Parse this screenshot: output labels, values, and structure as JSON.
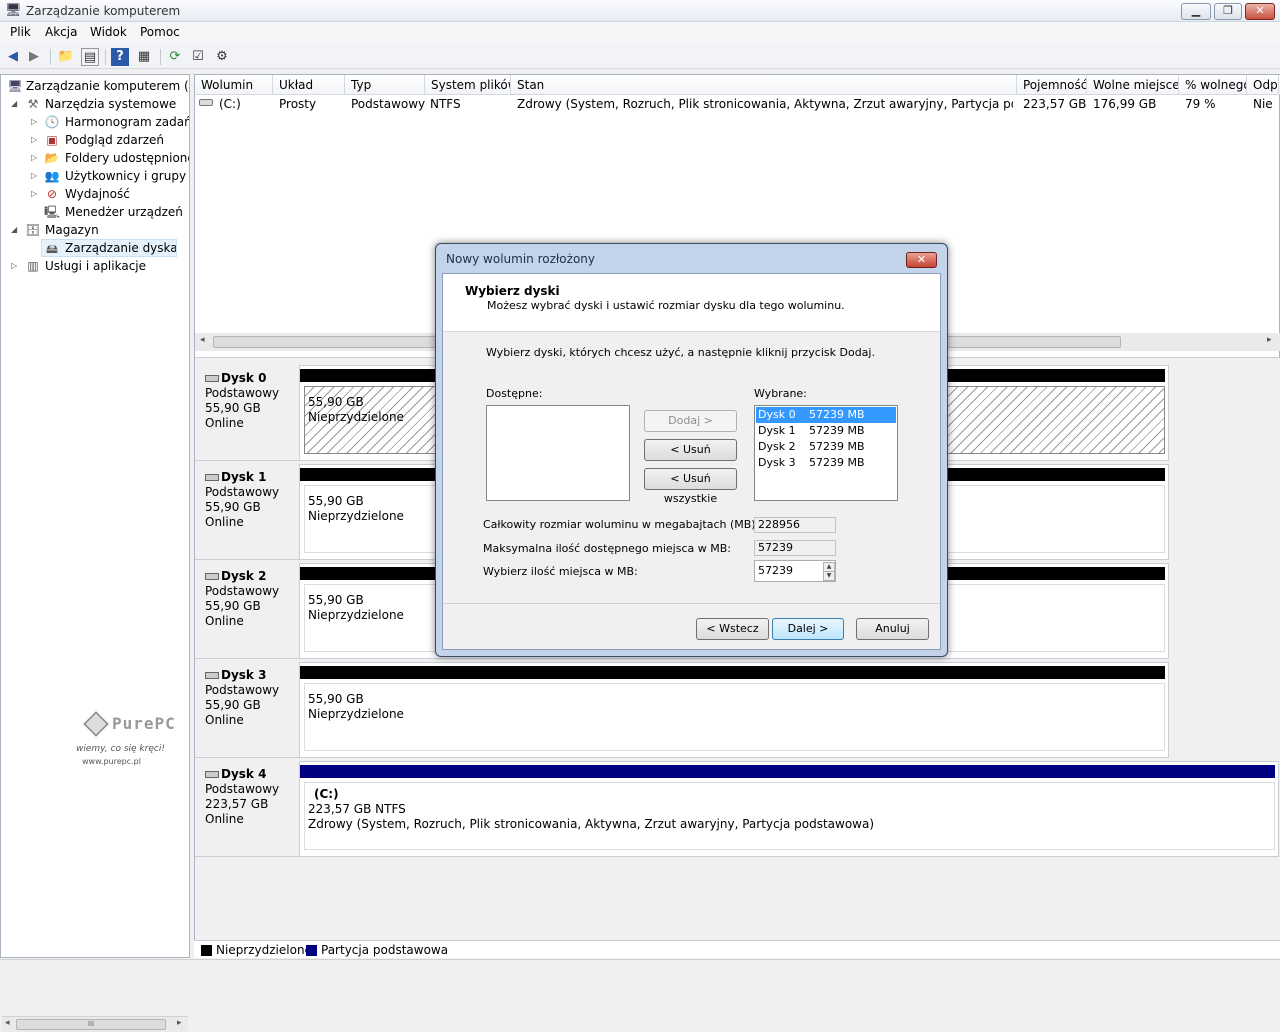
{
  "window": {
    "title": "Zarządzanie komputerem",
    "minimize": "▁",
    "maximize": "❐",
    "close": "✕"
  },
  "menu": [
    "Plik",
    "Akcja",
    "Widok",
    "Pomoc"
  ],
  "tree": {
    "root": "Zarządzanie komputerem (lokalne)",
    "items": [
      {
        "label": "Narzędzia systemowe",
        "icon": "tools-icon"
      },
      {
        "label": "Harmonogram zadań",
        "icon": "clock-icon"
      },
      {
        "label": "Podgląd zdarzeń",
        "icon": "event-viewer-icon"
      },
      {
        "label": "Foldery udostępnione",
        "icon": "shared-folder-icon"
      },
      {
        "label": "Użytkownicy i grupy lokalne",
        "icon": "users-icon"
      },
      {
        "label": "Wydajność",
        "icon": "performance-icon"
      },
      {
        "label": "Menedżer urządzeń",
        "icon": "device-manager-icon"
      },
      {
        "label": "Magazyn",
        "icon": "storage-icon"
      },
      {
        "label": "Zarządzanie dyskami",
        "icon": "disk-management-icon"
      },
      {
        "label": "Usługi i aplikacje",
        "icon": "services-icon"
      }
    ],
    "scroll_mid": "III"
  },
  "volume_table": {
    "columns": [
      "Wolumin",
      "Układ",
      "Typ",
      "System plików",
      "Stan",
      "Pojemność",
      "Wolne miejsce",
      "% wolnego",
      "Odporność na błędy"
    ],
    "rows": [
      [
        "(C:)",
        "Prosty",
        "Podstawowy",
        "NTFS",
        "Zdrowy (System, Rozruch, Plik stronicowania, Aktywna, Zrzut awaryjny, Partycja podstawowa)",
        "223,57 GB",
        "176,99 GB",
        "79 %",
        "Nie"
      ]
    ]
  },
  "disks": [
    {
      "name": "Dysk 0",
      "type": "Podstawowy",
      "size": "55,90 GB",
      "status": "Online",
      "part_size": "55,90 GB",
      "part_state": "Nieprzydzielone"
    },
    {
      "name": "Dysk 1",
      "type": "Podstawowy",
      "size": "55,90 GB",
      "status": "Online",
      "part_size": "55,90 GB",
      "part_state": "Nieprzydzielone"
    },
    {
      "name": "Dysk 2",
      "type": "Podstawowy",
      "size": "55,90 GB",
      "status": "Online",
      "part_size": "55,90 GB",
      "part_state": "Nieprzydzielone"
    },
    {
      "name": "Dysk 3",
      "type": "Podstawowy",
      "size": "55,90 GB",
      "status": "Online",
      "part_size": "55,90 GB",
      "part_state": "Nieprzydzielone"
    },
    {
      "name": "Dysk 4",
      "type": "Podstawowy",
      "size": "223,57 GB",
      "status": "Online",
      "part_name": "(C:)",
      "part_size": "223,57 GB NTFS",
      "part_state": "Zdrowy (System, Rozruch, Plik stronicowania, Aktywna, Zrzut awaryjny, Partycja podstawowa)"
    }
  ],
  "legend": {
    "unallocated": "Nieprzydzielone",
    "primary": "Partycja podstawowa",
    "unallocated_color": "#000000",
    "primary_color": "#000080"
  },
  "watermark": {
    "brand": "PurePC",
    "tagline": "wiemy, co się kręci!",
    "url": "www.purepc.pl"
  },
  "dialog": {
    "title": "Nowy wolumin rozłożony",
    "heading": "Wybierz dyski",
    "subheading": "Możesz wybrać dyski i ustawić rozmiar dysku dla tego woluminu.",
    "instruction": "Wybierz dyski, których chcesz użyć, a następnie kliknij przycisk Dodaj.",
    "available_label": "Dostępne:",
    "selected_label": "Wybrane:",
    "add_button": "Dodaj >",
    "remove_button": "< Usuń",
    "remove_all_button": "< Usuń wszystkie",
    "selected_disks": [
      {
        "disk": "Dysk 0",
        "size": "57239 MB"
      },
      {
        "disk": "Dysk 1",
        "size": "57239 MB"
      },
      {
        "disk": "Dysk 2",
        "size": "57239 MB"
      },
      {
        "disk": "Dysk 3",
        "size": "57239 MB"
      }
    ],
    "total_label": "Całkowity rozmiar woluminu w megabajtach (MB):",
    "total_value": "228956",
    "max_label": "Maksymalna ilość dostępnego miejsca w MB:",
    "max_value": "57239",
    "choose_label": "Wybierz ilość miejsca w MB:",
    "choose_value": "57239",
    "back_button": "< Wstecz",
    "next_button": "Dalej >",
    "cancel_button": "Anuluj"
  }
}
